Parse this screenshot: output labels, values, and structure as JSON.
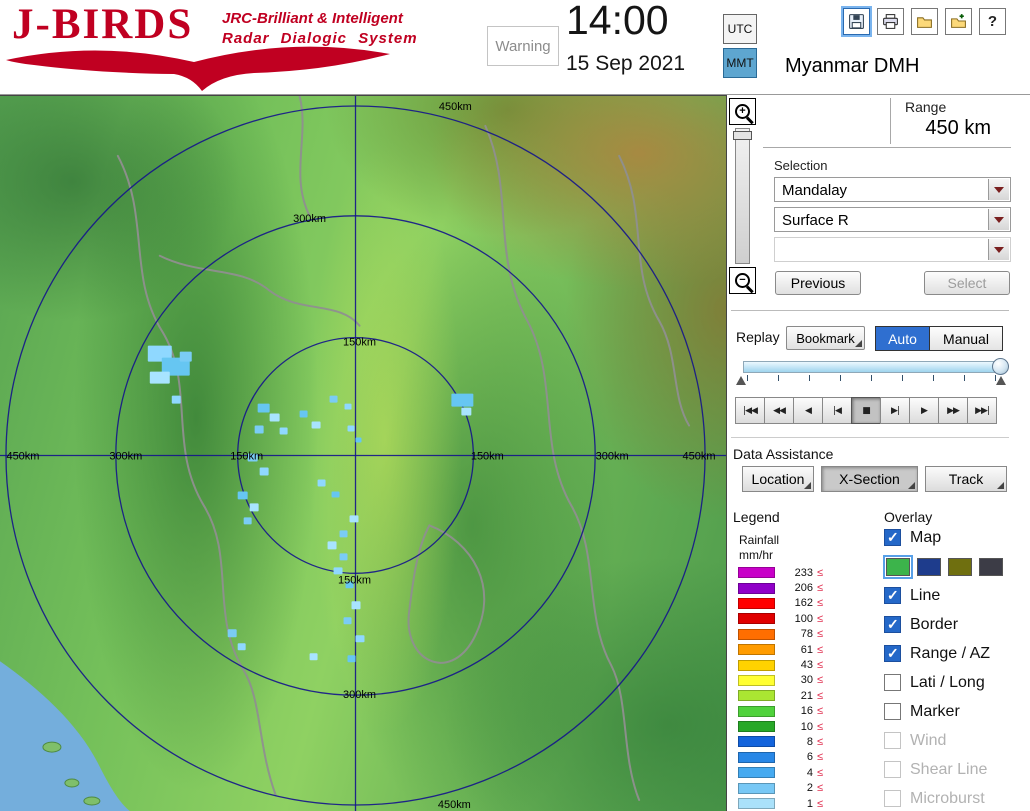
{
  "colors": {
    "accent_blue": "#2468C8",
    "logo_red": "#C00021",
    "sea": "#74AEDC",
    "ring": "#14148C",
    "boundary": "#8F8F8F",
    "legend_leq": "#E03050",
    "mmt_bg": "#5EA6D0",
    "auto_bg": "#2F6FD0"
  },
  "header": {
    "logo_title": "J-BIRDS",
    "logo_subtitle1": "JRC-Brilliant & Intelligent",
    "logo_subtitle2": "Radar Dialogic System",
    "warning": "Warning",
    "time": "14:00",
    "date": "15 Sep 2021",
    "utc": "UTC",
    "mmt": "MMT",
    "station": "Myanmar DMH",
    "toolbar_icons": [
      "save",
      "print",
      "open-folder",
      "export",
      "help"
    ],
    "help_glyph": "?"
  },
  "zoom": {
    "in_glyph": "+",
    "out_glyph": "−"
  },
  "range": {
    "label": "Range",
    "value": "450 km"
  },
  "selection": {
    "label": "Selection",
    "dropdown1": "Mandalay",
    "dropdown2": "Surface R",
    "dropdown3": "",
    "previous": "Previous",
    "select": "Select",
    "select_disabled": true
  },
  "replay": {
    "label": "Replay",
    "bookmark": "Bookmark",
    "modes": [
      {
        "label": "Auto",
        "active": true
      },
      {
        "label": "Manual",
        "active": false
      }
    ],
    "playback": [
      {
        "glyph": "|◀◀",
        "name": "jump-to-start",
        "active": false
      },
      {
        "glyph": "◀◀",
        "name": "fast-rewind",
        "active": false
      },
      {
        "glyph": "◀",
        "name": "play-reverse",
        "active": false
      },
      {
        "glyph": "|◀",
        "name": "step-back",
        "active": false
      },
      {
        "glyph": "■",
        "name": "stop",
        "active": true
      },
      {
        "glyph": "▶|",
        "name": "step-forward",
        "active": false
      },
      {
        "glyph": "▶",
        "name": "play",
        "active": false
      },
      {
        "glyph": "▶▶",
        "name": "fast-forward",
        "active": false
      },
      {
        "glyph": "▶▶|",
        "name": "jump-to-end",
        "active": false
      }
    ]
  },
  "data_assistance": {
    "label": "Data Assistance",
    "buttons": [
      {
        "label": "Location",
        "active": false
      },
      {
        "label": "X-Section",
        "active": true
      },
      {
        "label": "Track",
        "active": false
      }
    ]
  },
  "legend": {
    "label": "Legend",
    "unit_line1": "Rainfall",
    "unit_line2": "mm/hr",
    "suffix": "≤",
    "entries": [
      {
        "value": "233",
        "color": "#C800C8"
      },
      {
        "value": "206",
        "color": "#9000C8"
      },
      {
        "value": "162",
        "color": "#FF0000"
      },
      {
        "value": "100",
        "color": "#E00000"
      },
      {
        "value": "78",
        "color": "#FF6E00"
      },
      {
        "value": "61",
        "color": "#FF9C00"
      },
      {
        "value": "43",
        "color": "#FFD200"
      },
      {
        "value": "30",
        "color": "#FFFF32"
      },
      {
        "value": "21",
        "color": "#AAE632"
      },
      {
        "value": "16",
        "color": "#50D23C"
      },
      {
        "value": "10",
        "color": "#28A828"
      },
      {
        "value": "8",
        "color": "#1464DC"
      },
      {
        "value": "6",
        "color": "#2887E6"
      },
      {
        "value": "4",
        "color": "#46AAF0"
      },
      {
        "value": "2",
        "color": "#78C8F5"
      },
      {
        "value": "1",
        "color": "#AAE1FA"
      }
    ]
  },
  "overlay": {
    "label": "Overlay",
    "map_swatches": [
      {
        "color": "#3CB44B",
        "selected": true
      },
      {
        "color": "#1E3C8C",
        "selected": false
      },
      {
        "color": "#6F6F0F",
        "selected": false
      },
      {
        "color": "#3C3C46",
        "selected": false
      }
    ],
    "items": [
      {
        "label": "Map",
        "checked": true,
        "enabled": true
      },
      {
        "label": "Line",
        "checked": true,
        "enabled": true
      },
      {
        "label": "Border",
        "checked": true,
        "enabled": true
      },
      {
        "label": "Range / AZ",
        "checked": true,
        "enabled": true
      },
      {
        "label": "Lati / Long",
        "checked": false,
        "enabled": true
      },
      {
        "label": "Marker",
        "checked": false,
        "enabled": true
      },
      {
        "label": "Wind",
        "checked": false,
        "enabled": false
      },
      {
        "label": "Shear Line",
        "checked": false,
        "enabled": false
      },
      {
        "label": "Microburst",
        "checked": false,
        "enabled": false
      }
    ]
  },
  "map": {
    "ring_labels": [
      "450km",
      "300km",
      "150km",
      "450km",
      "300km",
      "150km",
      "150km",
      "300km",
      "450km",
      "150km",
      "300km",
      "450km"
    ],
    "echo_colors": [
      "#8FD8FF",
      "#66C6F2",
      "#A8E4FF",
      "#7ACCF5"
    ],
    "echoes": [
      [
        148,
        250,
        24,
        16
      ],
      [
        162,
        262,
        28,
        18
      ],
      [
        150,
        276,
        20,
        12
      ],
      [
        180,
        256,
        12,
        10
      ],
      [
        172,
        300,
        9,
        8
      ],
      [
        258,
        308,
        12,
        9
      ],
      [
        270,
        318,
        10,
        8
      ],
      [
        255,
        330,
        9,
        8
      ],
      [
        280,
        332,
        8,
        7
      ],
      [
        300,
        315,
        8,
        7
      ],
      [
        312,
        326,
        9,
        7
      ],
      [
        330,
        300,
        8,
        7
      ],
      [
        345,
        308,
        7,
        6
      ],
      [
        452,
        298,
        22,
        13
      ],
      [
        462,
        312,
        10,
        8
      ],
      [
        248,
        358,
        10,
        8
      ],
      [
        260,
        372,
        9,
        8
      ],
      [
        238,
        396,
        10,
        8
      ],
      [
        250,
        408,
        9,
        8
      ],
      [
        244,
        422,
        8,
        7
      ],
      [
        318,
        384,
        8,
        7
      ],
      [
        332,
        396,
        8,
        6
      ],
      [
        350,
        420,
        9,
        7
      ],
      [
        340,
        435,
        8,
        7
      ],
      [
        348,
        330,
        7,
        6
      ],
      [
        356,
        342,
        6,
        5
      ],
      [
        328,
        446,
        9,
        8
      ],
      [
        340,
        458,
        8,
        7
      ],
      [
        334,
        472,
        9,
        7
      ],
      [
        346,
        486,
        8,
        7
      ],
      [
        352,
        506,
        9,
        8
      ],
      [
        344,
        522,
        8,
        7
      ],
      [
        356,
        540,
        9,
        7
      ],
      [
        348,
        560,
        8,
        7
      ],
      [
        310,
        558,
        8,
        7
      ],
      [
        228,
        534,
        9,
        8
      ],
      [
        238,
        548,
        8,
        7
      ]
    ]
  }
}
